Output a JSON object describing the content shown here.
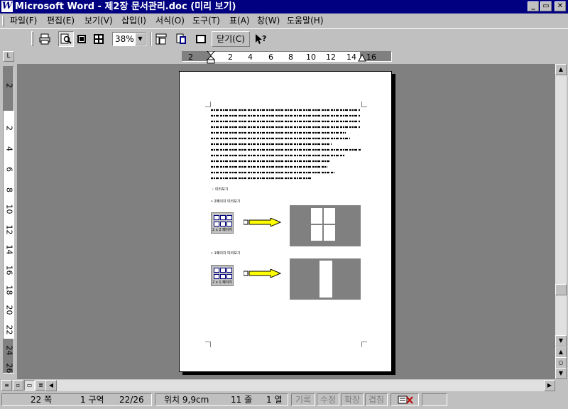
{
  "window": {
    "title": "Microsoft Word - 제2장 문서관리.doc (미리 보기)",
    "icon": "word-icon"
  },
  "menu": [
    "파일(F)",
    "편집(E)",
    "보기(V)",
    "삽입(I)",
    "서식(O)",
    "도구(T)",
    "표(A)",
    "창(W)",
    "도움말(H)"
  ],
  "toolbar": {
    "zoom": "38%",
    "close_label": "닫기(C)",
    "icons": [
      "print-icon",
      "magnifier-icon",
      "one-page-icon",
      "multiple-pages-icon",
      "view-ruler-icon",
      "shrink-to-fit-icon",
      "full-screen-icon",
      "context-help-icon"
    ]
  },
  "ruler": {
    "h_ticks": [
      "2",
      "2",
      "4",
      "6",
      "8",
      "10",
      "12",
      "14",
      "16"
    ],
    "v_ticks": [
      "2",
      "2",
      "4",
      "6",
      "8",
      "10",
      "12",
      "14",
      "16",
      "18",
      "20",
      "22",
      "24",
      "26"
    ]
  },
  "document": {
    "section_heading": "♢  미리보기",
    "label_one": "• 2페이지 미리보기",
    "label_two": "• 1페이지 미리보기",
    "caption_one": "2 x 2 페이지",
    "caption_two": "2 x 1 페이지"
  },
  "status": {
    "page": "22 쪽",
    "section": "1 구역",
    "page_of": "22/26",
    "position": "위치 9,9cm",
    "line": "11 줄",
    "column": "1 열",
    "modes": [
      "기록",
      "수정",
      "확장",
      "겹침"
    ]
  }
}
